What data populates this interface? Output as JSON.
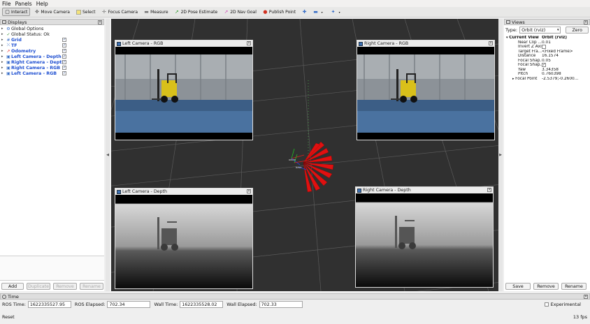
{
  "menu": {
    "file": "File",
    "panels": "Panels",
    "help": "Help"
  },
  "toolbar": {
    "interact": "Interact",
    "move_camera": "Move Camera",
    "select": "Select",
    "focus_camera": "Focus Camera",
    "measure": "Measure",
    "pose_estimate": "2D Pose Estimate",
    "nav_goal": "2D Nav Goal",
    "publish_point": "Publish Point"
  },
  "displays": {
    "title": "Displays",
    "items": [
      {
        "label": "Global Options",
        "icon": "gear-icon",
        "check": ""
      },
      {
        "label": "Global Status: Ok",
        "icon": "check-icon",
        "check": ""
      },
      {
        "label": "Grid",
        "icon": "grid-icon",
        "check": "✓"
      },
      {
        "label": "TF",
        "icon": "tf-icon",
        "check": "✓"
      },
      {
        "label": "Odometry",
        "icon": "odometry-icon",
        "check": "✓"
      },
      {
        "label": "Left Camera - Depth",
        "icon": "camera-icon",
        "check": "✓"
      },
      {
        "label": "Right Camera - Depth",
        "icon": "camera-icon",
        "check": "✓"
      },
      {
        "label": "Right Camera - RGB",
        "icon": "camera-icon",
        "check": "✓"
      },
      {
        "label": "Left Camera - RGB",
        "icon": "camera-icon",
        "check": "✓"
      }
    ],
    "add": "Add",
    "duplicate": "Duplicate",
    "remove": "Remove",
    "rename": "Rename"
  },
  "cameras": {
    "left_rgb": "Left Camera - RGB",
    "right_rgb": "Right Camera - RGB",
    "left_depth": "Left Camera - Depth",
    "right_depth": "Right Camera - Depth"
  },
  "views": {
    "title": "Views",
    "type_label": "Type:",
    "type_value": "Orbit (rviz)",
    "zero": "Zero",
    "current_view": "Current View",
    "current_view_value": "Orbit (rviz)",
    "props": [
      {
        "k": "Near Clip ...",
        "v": "0.01"
      },
      {
        "k": "Invert Z Axis",
        "v": ""
      },
      {
        "k": "Target Fra...",
        "v": "<Fixed Frame>"
      },
      {
        "k": "Distance",
        "v": "16.1574"
      },
      {
        "k": "Focal Shap...",
        "v": "0.05"
      },
      {
        "k": "Focal Shap...",
        "v": "✓"
      },
      {
        "k": "Yaw",
        "v": "3.34358"
      },
      {
        "k": "Pitch",
        "v": "0.760398"
      },
      {
        "k": "Focal Point",
        "v": "-2.5379;-0.2600..."
      }
    ],
    "save": "Save",
    "remove": "Remove",
    "rename": "Rename"
  },
  "time": {
    "title": "Time",
    "ros_time_label": "ROS Time:",
    "ros_time": "1622335527.95",
    "ros_elapsed_label": "ROS Elapsed:",
    "ros_elapsed": "702.34",
    "wall_time_label": "Wall Time:",
    "wall_time": "1622335528.02",
    "wall_elapsed_label": "Wall Elapsed:",
    "wall_elapsed": "702.33",
    "experimental": "Experimental"
  },
  "status": {
    "reset": "Reset",
    "fps": "13 fps"
  },
  "colors": {
    "accent": "#1e4fd1",
    "viewport_bg": "#303030",
    "odometry": "#e01010"
  }
}
